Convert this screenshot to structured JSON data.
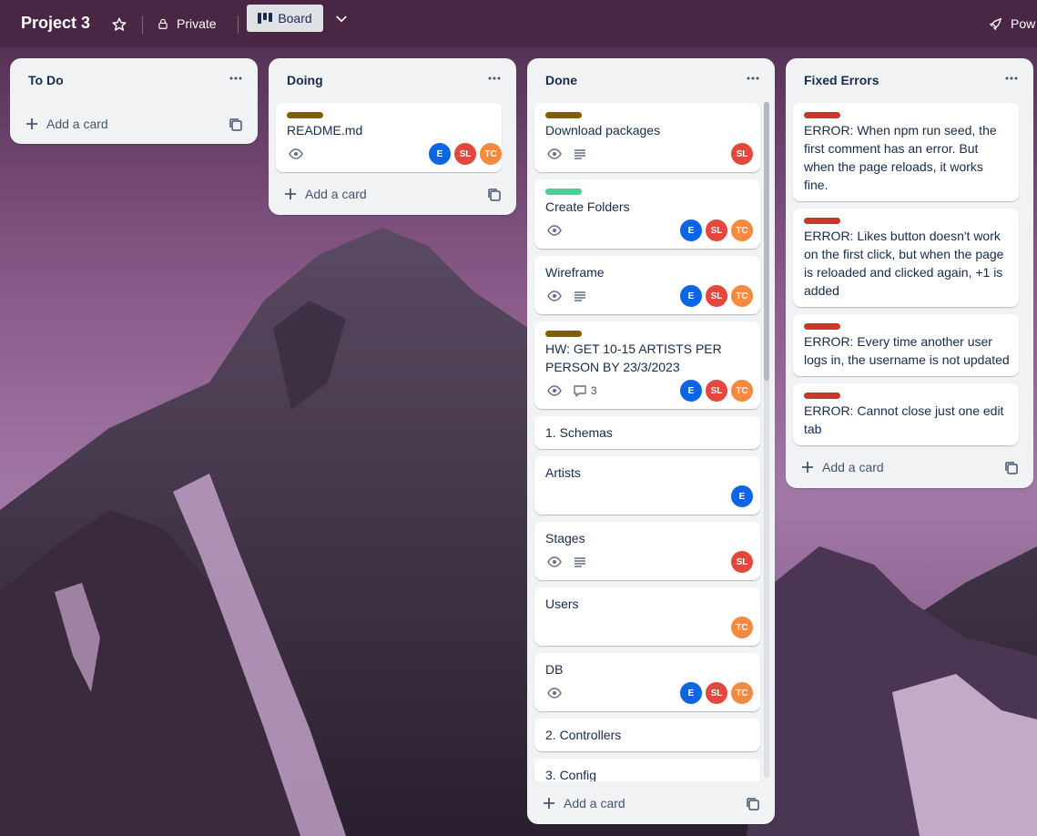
{
  "header": {
    "title": "Project 3",
    "visibility": "Private",
    "view": "Board",
    "power_ups": "Pow"
  },
  "colors": {
    "brown_label": "#7f5f01",
    "green_label": "#4bce97",
    "red_label": "#c9372c",
    "avatar_e": "#0c66e4",
    "avatar_sl": "#e2483d",
    "avatar_tc": "#f38a3f"
  },
  "icons": [
    "star-icon",
    "lock-icon",
    "board-icon",
    "chevron-down-icon",
    "rocket-icon",
    "more-icon",
    "plus-icon",
    "template-icon",
    "eye-icon",
    "description-icon",
    "comment-icon"
  ],
  "avatars": {
    "e": "E",
    "sl": "SL",
    "tc": "TC"
  },
  "lists": {
    "todo": {
      "title": "To Do",
      "add": "Add a card"
    },
    "doing": {
      "title": "Doing",
      "add": "Add a card",
      "cards": [
        {
          "title": "README.md"
        }
      ]
    },
    "done": {
      "title": "Done",
      "add": "Add a card",
      "cards": [
        {
          "title": "Download packages"
        },
        {
          "title": "Create Folders"
        },
        {
          "title": "Wireframe"
        },
        {
          "title": "HW: GET 10-15 ARTISTS PER PERSON BY 23/3/2023",
          "comments": "3"
        },
        {
          "title": "1. Schemas"
        },
        {
          "title": "Artists"
        },
        {
          "title": "Stages"
        },
        {
          "title": "Users"
        },
        {
          "title": "DB"
        },
        {
          "title": "2. Controllers"
        },
        {
          "title": "3. Config"
        }
      ]
    },
    "fixed": {
      "title": "Fixed Errors",
      "add": "Add a card",
      "cards": [
        {
          "title": "ERROR: When npm run seed, the first comment has an error. But when the page reloads, it works fine."
        },
        {
          "title": "ERROR: Likes button doesn't work on the first click, but when the page is reloaded and clicked again, +1 is added"
        },
        {
          "title": "ERROR: Every time another user logs in, the username is not updated"
        },
        {
          "title": "ERROR: Cannot close just one edit tab"
        }
      ]
    }
  }
}
